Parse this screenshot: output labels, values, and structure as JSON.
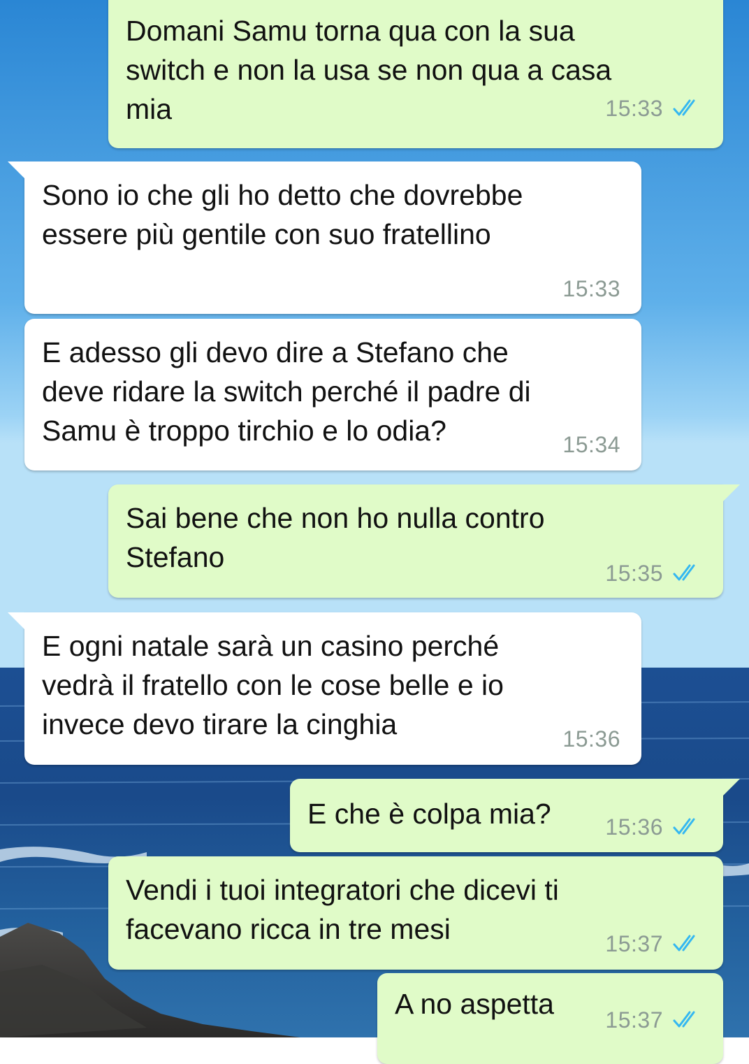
{
  "colors": {
    "outgoing_bubble": "#e0fbc8",
    "incoming_bubble": "#ffffff",
    "timestamp": "#8b9a93",
    "read_ticks": "#34b7f1",
    "sky_top": "#2f8fd8",
    "sea": "#1f4f8f"
  },
  "icons": {
    "read_receipt": "double-check-icon"
  },
  "messages": [
    {
      "direction": "out",
      "text": "Domani Samu torna qua con la sua\nswitch e non la usa se non qua a casa\nmia",
      "time": "15:33",
      "status": "read"
    },
    {
      "direction": "in",
      "text": "Sono io che gli ho detto che dovrebbe\nessere più gentile con suo fratellino",
      "time": "15:33"
    },
    {
      "direction": "in",
      "text": "E adesso gli devo dire a Stefano che\ndeve ridare la switch perché il padre di\nSamu è troppo tirchio e lo odia?",
      "time": "15:34"
    },
    {
      "direction": "out",
      "text": "Sai bene che non ho nulla contro\nStefano",
      "time": "15:35",
      "status": "read"
    },
    {
      "direction": "in",
      "text": "E ogni natale sarà un casino perché\nvedrà il fratello con le cose belle e io\ninvece devo tirare la cinghia",
      "time": "15:36"
    },
    {
      "direction": "out",
      "text": "E che è colpa mia?",
      "time": "15:36",
      "status": "read"
    },
    {
      "direction": "out",
      "text": "Vendi i tuoi integratori che dicevi ti\nfacevano ricca in tre mesi",
      "time": "15:37",
      "status": "read"
    },
    {
      "direction": "out",
      "text": "A no aspetta",
      "time": "15:37",
      "status": "read"
    }
  ]
}
